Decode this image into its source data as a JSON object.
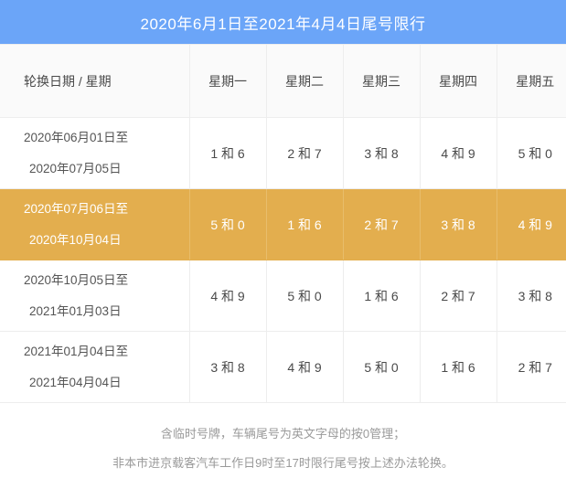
{
  "banner": {
    "title": "2020年6月1日至2021年4月4日尾号限行"
  },
  "table": {
    "headers": [
      "轮换日期 / 星期",
      "星期一",
      "星期二",
      "星期三",
      "星期四",
      "星期五"
    ],
    "rows": [
      {
        "date_line1": "2020年06月01日至",
        "date_line2": "2020年07月05日",
        "values": [
          "1 和 6",
          "2 和 7",
          "3 和 8",
          "4 和 9",
          "5 和 0"
        ],
        "highlighted": false
      },
      {
        "date_line1": "2020年07月06日至",
        "date_line2": "2020年10月04日",
        "values": [
          "5 和 0",
          "1 和 6",
          "2 和 7",
          "3 和 8",
          "4 和 9"
        ],
        "highlighted": true
      },
      {
        "date_line1": "2020年10月05日至",
        "date_line2": "2021年01月03日",
        "values": [
          "4 和 9",
          "5 和 0",
          "1 和 6",
          "2 和 7",
          "3 和 8"
        ],
        "highlighted": false
      },
      {
        "date_line1": "2021年01月04日至",
        "date_line2": "2021年04月04日",
        "values": [
          "3 和 8",
          "4 和 9",
          "5 和 0",
          "1 和 6",
          "2 和 7"
        ],
        "highlighted": false
      }
    ]
  },
  "notes": [
    "含临时号牌，车辆尾号为英文字母的按0管理；",
    "非本市进京载客汽车工作日9时至17时限行尾号按上述办法轮换。"
  ],
  "colors": {
    "banner_blue": "#6BA5F8",
    "highlight_orange": "#E3AE4E",
    "header_row_bg": "#fafafa",
    "text_dark": "#4a4a4a",
    "text_muted": "#9a9a9a",
    "border": "#ededed"
  }
}
